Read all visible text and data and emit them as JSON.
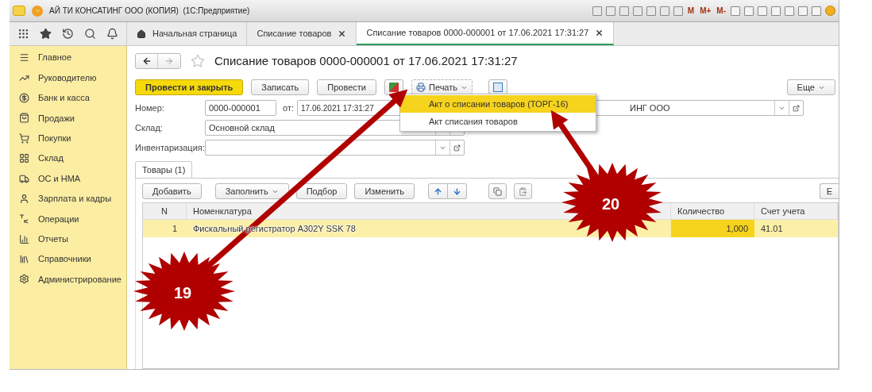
{
  "window": {
    "title": "АЙ ТИ КОНСАТИНГ ООО (КОПИЯ)  (1С:Предприятие)",
    "memory_buttons": [
      "M",
      "M+",
      "M-"
    ]
  },
  "nav_tabs": [
    {
      "label": "Начальная страница",
      "kind": "home",
      "selected": false
    },
    {
      "label": "Списание товаров",
      "kind": "closable",
      "selected": false
    },
    {
      "label": "Списание товаров 0000-000001 от 17.06.2021 17:31:27",
      "kind": "closable",
      "selected": true
    }
  ],
  "sidebar": {
    "items": [
      {
        "label": "Главное"
      },
      {
        "label": "Руководителю"
      },
      {
        "label": "Банк и касса"
      },
      {
        "label": "Продажи"
      },
      {
        "label": "Покупки"
      },
      {
        "label": "Склад"
      },
      {
        "label": "ОС и НМА"
      },
      {
        "label": "Зарплата и кадры"
      },
      {
        "label": "Операции"
      },
      {
        "label": "Отчеты"
      },
      {
        "label": "Справочники"
      },
      {
        "label": "Администрирование"
      }
    ]
  },
  "form": {
    "title": "Списание товаров 0000-000001 от 17.06.2021 17:31:27",
    "buttons": [
      {
        "label": "Провести и закрыть",
        "kind": "primary"
      },
      {
        "label": "Записать",
        "kind": "plain"
      },
      {
        "label": "Провести",
        "kind": "plain"
      }
    ],
    "print_button": "Печать",
    "more_button": "Еще",
    "print_menu": [
      {
        "label": "Акт о списании товаров (ТОРГ-16)",
        "selected": true
      },
      {
        "label": "Акт списания товаров",
        "selected": false
      }
    ],
    "number": {
      "label": "Номер:",
      "value": "0000-000001"
    },
    "date": {
      "label": "от:",
      "value": "17.06.2021 17:31:27"
    },
    "organization": {
      "value": "ИНГ ООО"
    },
    "warehouse": {
      "label": "Склад:",
      "value": "Основной склад"
    },
    "inventory": {
      "label": "Инвентаризация:"
    },
    "section_tab": "Товары (1)",
    "table_buttons": [
      {
        "label": "Добавить",
        "dropdown": false
      },
      {
        "label": "Заполнить",
        "dropdown": true
      },
      {
        "label": "Подбор",
        "dropdown": false
      },
      {
        "label": "Изменить",
        "dropdown": false
      }
    ],
    "table_more_button": "Е",
    "table": {
      "columns": [
        "N",
        "Номенклатура",
        "Количество",
        "Счет учета"
      ],
      "rows": [
        {
          "cells": [
            "1",
            "Фискальный регистратор A302Y SSK 78",
            "1,000",
            "41.01"
          ],
          "selected": true
        }
      ]
    }
  },
  "annotations": [
    {
      "label": "19"
    },
    {
      "label": "20"
    }
  ]
}
